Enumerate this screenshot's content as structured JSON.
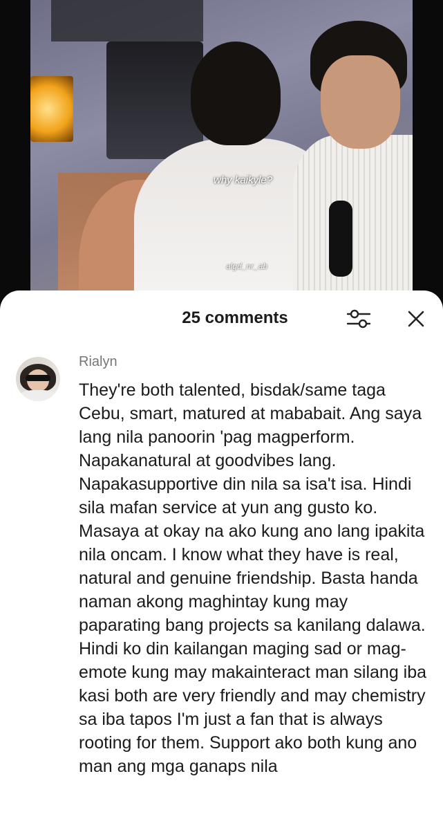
{
  "video": {
    "caption": "why kaikyle?",
    "watermark": "algd_nr_ab"
  },
  "comments_sheet": {
    "title": "25 comments",
    "filter_icon": "sliders-icon",
    "close_icon": "close-icon"
  },
  "comment": {
    "username": "Rialyn",
    "text": "They're both talented, bisdak/same taga Cebu, smart, matured at mababait. Ang saya lang nila panoorin 'pag magperform. Napakanatural at goodvibes lang. Napakasupportive din nila sa isa't isa. Hindi sila mafan service at yun ang gusto ko. Masaya at okay na ako kung ano lang ipakita nila oncam. I know what they have is real, natural and genuine friendship. Basta handa naman akong maghintay kung may paparating bang projects sa kanilang dalawa. Hindi ko din kailangan maging sad or mag-emote kung may makainteract man silang iba kasi both are very friendly and may chemistry sa iba tapos I'm just a fan that is always rooting for them. Support ako both kung ano man ang mga ganaps nila"
  },
  "colors": {
    "sheet_bg": "#ffffff",
    "text_primary": "#1b1b1b",
    "text_secondary": "#757575"
  }
}
